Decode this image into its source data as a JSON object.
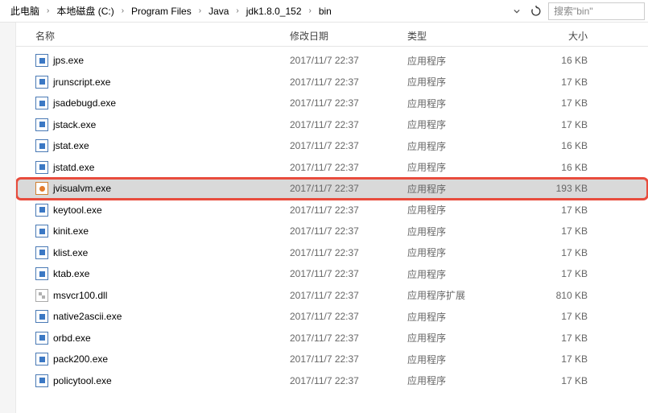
{
  "breadcrumb": {
    "items": [
      "此电脑",
      "本地磁盘 (C:)",
      "Program Files",
      "Java",
      "jdk1.8.0_152",
      "bin"
    ]
  },
  "search": {
    "placeholder": "搜索\"bin\""
  },
  "columns": {
    "name": "名称",
    "date": "修改日期",
    "type": "类型",
    "size": "大小"
  },
  "files": [
    {
      "name": "jps.exe",
      "date": "2017/11/7 22:37",
      "type": "应用程序",
      "size": "16 KB",
      "icon": "exe"
    },
    {
      "name": "jrunscript.exe",
      "date": "2017/11/7 22:37",
      "type": "应用程序",
      "size": "17 KB",
      "icon": "exe"
    },
    {
      "name": "jsadebugd.exe",
      "date": "2017/11/7 22:37",
      "type": "应用程序",
      "size": "17 KB",
      "icon": "exe"
    },
    {
      "name": "jstack.exe",
      "date": "2017/11/7 22:37",
      "type": "应用程序",
      "size": "17 KB",
      "icon": "exe"
    },
    {
      "name": "jstat.exe",
      "date": "2017/11/7 22:37",
      "type": "应用程序",
      "size": "16 KB",
      "icon": "exe"
    },
    {
      "name": "jstatd.exe",
      "date": "2017/11/7 22:37",
      "type": "应用程序",
      "size": "16 KB",
      "icon": "exe"
    },
    {
      "name": "jvisualvm.exe",
      "date": "2017/11/7 22:37",
      "type": "应用程序",
      "size": "193 KB",
      "icon": "jvm",
      "selected": true,
      "highlighted": true
    },
    {
      "name": "keytool.exe",
      "date": "2017/11/7 22:37",
      "type": "应用程序",
      "size": "17 KB",
      "icon": "exe"
    },
    {
      "name": "kinit.exe",
      "date": "2017/11/7 22:37",
      "type": "应用程序",
      "size": "17 KB",
      "icon": "exe"
    },
    {
      "name": "klist.exe",
      "date": "2017/11/7 22:37",
      "type": "应用程序",
      "size": "17 KB",
      "icon": "exe"
    },
    {
      "name": "ktab.exe",
      "date": "2017/11/7 22:37",
      "type": "应用程序",
      "size": "17 KB",
      "icon": "exe"
    },
    {
      "name": "msvcr100.dll",
      "date": "2017/11/7 22:37",
      "type": "应用程序扩展",
      "size": "810 KB",
      "icon": "dll"
    },
    {
      "name": "native2ascii.exe",
      "date": "2017/11/7 22:37",
      "type": "应用程序",
      "size": "17 KB",
      "icon": "exe"
    },
    {
      "name": "orbd.exe",
      "date": "2017/11/7 22:37",
      "type": "应用程序",
      "size": "17 KB",
      "icon": "exe"
    },
    {
      "name": "pack200.exe",
      "date": "2017/11/7 22:37",
      "type": "应用程序",
      "size": "17 KB",
      "icon": "exe"
    },
    {
      "name": "policytool.exe",
      "date": "2017/11/7 22:37",
      "type": "应用程序",
      "size": "17 KB",
      "icon": "exe"
    }
  ]
}
